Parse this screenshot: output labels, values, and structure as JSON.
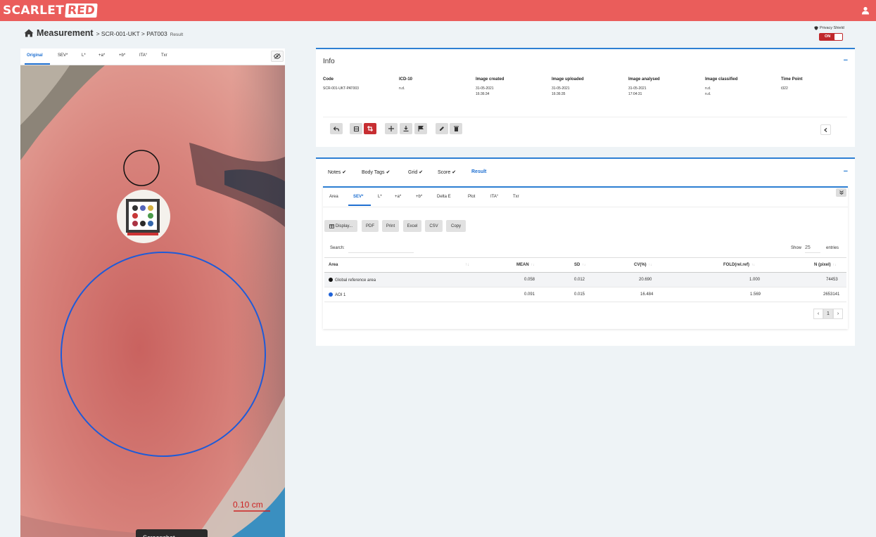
{
  "brand": {
    "part1": "SCARLET",
    "part2": "RED",
    "accent": "#ea5d5b"
  },
  "breadcrumb": {
    "title": "Measurement",
    "path": "> SCR-001-UKT > PAT003",
    "suffix": "Result"
  },
  "privacy": {
    "label": "Privacy Shield",
    "state": "ON"
  },
  "image_tabs": [
    "Original",
    "SEV*",
    "L*",
    "+a*",
    "+b*",
    "ITA°",
    "Txr"
  ],
  "image_tab_active": "Original",
  "image": {
    "scale_label": "0.10 cm",
    "tooltip": "Screenshot"
  },
  "info": {
    "title": "Info",
    "columns": [
      {
        "h": "Code",
        "v1": "SCR-001-UKT-PAT003",
        "v2": ""
      },
      {
        "h": "ICD-10",
        "v1": "n.d.",
        "v2": ""
      },
      {
        "h": "Image created",
        "v1": "31-05-2021",
        "v2": "16:36:34"
      },
      {
        "h": "Image uploaded",
        "v1": "31-05-2021",
        "v2": "16:36:35"
      },
      {
        "h": "Image analysed",
        "v1": "31-05-2021",
        "v2": "17:04:31"
      },
      {
        "h": "Image classified",
        "v1": "n.d.",
        "v2": "n.d."
      },
      {
        "h": "Time Point",
        "v1": "t322",
        "v2": ""
      }
    ],
    "toolbar_icons": [
      "undo-icon",
      "layers-icon",
      "crop-icon",
      "move-icon",
      "download-icon",
      "flag-icon",
      "edit-icon",
      "trash-icon"
    ]
  },
  "result": {
    "tabs": [
      {
        "label": "Notes",
        "check": "✔"
      },
      {
        "label": "Body Tags",
        "check": "✔"
      },
      {
        "label": "Grid",
        "check": "✔"
      },
      {
        "label": "Score",
        "check": "✔"
      },
      {
        "label": "Result",
        "check": ""
      }
    ],
    "active_tab": "Result",
    "subtabs": [
      "Area",
      "SEV*",
      "L*",
      "+a*",
      "+b*",
      "Delta E",
      "Plot",
      "ITA°",
      "Txr"
    ],
    "active_subtab": "SEV*",
    "export_buttons": [
      "Display...",
      "PDF",
      "Print",
      "Excel",
      "CSV",
      "Copy"
    ],
    "search_label": "Search:",
    "show_label": "Show",
    "show_value": "25",
    "entries_label": "entries",
    "table": {
      "headers": [
        "Area",
        "MEAN",
        "SD",
        "CV(%)",
        "FOLD(rel.ref)",
        "N (pixel)"
      ],
      "rows": [
        {
          "area": "Global reference area",
          "color": "#111111",
          "mean": "0.058",
          "sd": "0.012",
          "cv": "20.690",
          "fold": "1.000",
          "n": "74453"
        },
        {
          "area": "AOI 1",
          "color": "#1e62d8",
          "mean": "0.091",
          "sd": "0.015",
          "cv": "16.484",
          "fold": "1.569",
          "n": "2653141"
        }
      ]
    },
    "page": "1"
  }
}
